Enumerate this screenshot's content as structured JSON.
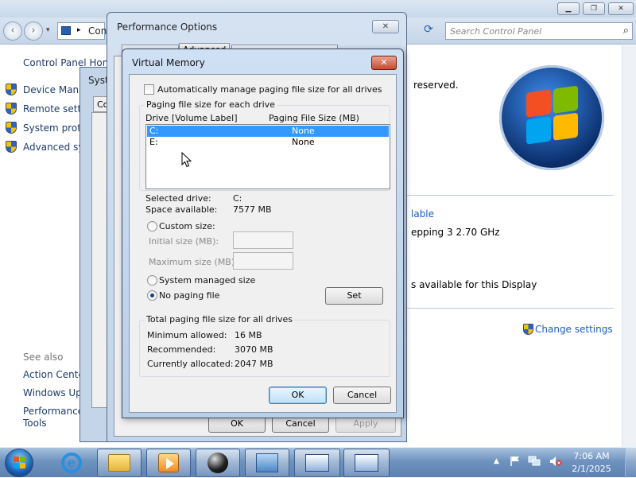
{
  "control_panel": {
    "address_text": "Control Panel",
    "search_placeholder": "Search Control Panel",
    "home_link": "Control Panel Home",
    "left_links": [
      "Device Manager",
      "Remote settings",
      "System protection",
      "Advanced system settings"
    ],
    "see_also": "See also",
    "see_also_links": [
      "Action Center",
      "Windows Update",
      "Performance",
      "Tools"
    ],
    "reserved_text": "reserved.",
    "rating_link": "lable",
    "processor_text": "epping 3   2.70 GHz",
    "display_text": "s available for this Display",
    "change_settings": "Change settings"
  },
  "system_properties": {
    "title": "System Properties",
    "tab_label": "Computer Name"
  },
  "performance_options": {
    "title": "Performance Options",
    "tab_advanced": "Advanced",
    "ok": "OK",
    "cancel": "Cancel",
    "apply": "Apply"
  },
  "virtual_memory": {
    "title": "Virtual Memory",
    "auto_manage_label": "Automatically manage paging file size for all drives",
    "auto_manage_checked": false,
    "group_title": "Paging file size for each drive",
    "col_drive": "Drive  [Volume Label]",
    "col_size": "Paging File Size (MB)",
    "drives": [
      {
        "drive": "C:",
        "size": "None",
        "selected": true
      },
      {
        "drive": "E:",
        "size": "None",
        "selected": false
      }
    ],
    "selected_drive_label": "Selected drive:",
    "selected_drive_value": "C:",
    "space_label": "Space available:",
    "space_value": "7577 MB",
    "custom_size": "Custom size:",
    "initial_size_label": "Initial size (MB):",
    "maximum_size_label": "Maximum size (MB):",
    "initial_size_value": "",
    "maximum_size_value": "",
    "system_managed": "System managed size",
    "no_paging": "No paging file",
    "selected_option": "No paging file",
    "set_button": "Set",
    "total_group_title": "Total paging file size for all drives",
    "minimum_label": "Minimum allowed:",
    "minimum_value": "16 MB",
    "recommended_label": "Recommended:",
    "recommended_value": "3070 MB",
    "current_label": "Currently allocated:",
    "current_value": "2047 MB",
    "ok": "OK",
    "cancel": "Cancel"
  },
  "taskbar": {
    "time": "7:06 AM",
    "date": "2/1/2025",
    "pinned": [
      "internet-explorer",
      "windows-explorer",
      "media-player",
      "ball-app",
      "control-panel",
      "system-properties",
      "system-properties-2"
    ]
  },
  "colors": {
    "selection": "#3399ff",
    "taskbar": "#6f93bf",
    "link": "#1e3a6b"
  }
}
